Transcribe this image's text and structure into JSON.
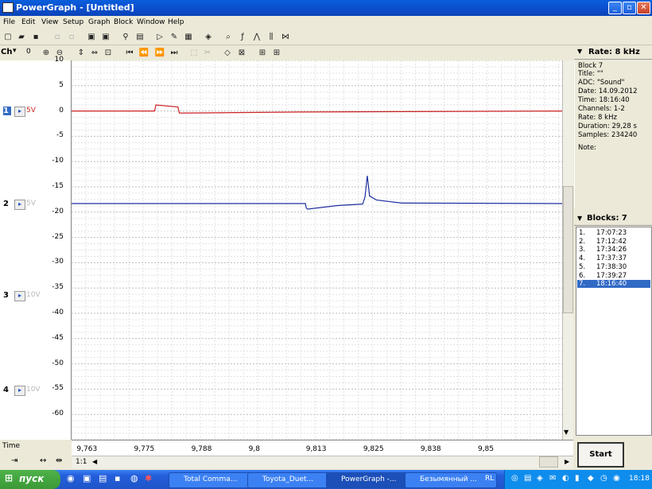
{
  "window": {
    "title": "PowerGraph - [Untitled]"
  },
  "menu": [
    "File",
    "Edit",
    "View",
    "Setup",
    "Graph",
    "Block",
    "Window",
    "Help"
  ],
  "toolbar2": {
    "ch_label": "Ch",
    "zero_label": "0"
  },
  "rate": {
    "label": "Rate: 8 kHz"
  },
  "info": {
    "block": "Block 7",
    "title": "Title: \"\"",
    "adc": "ADC: \"Sound\"",
    "date": "Date: 14.09.2012",
    "time": "Time: 18:16:40",
    "channels": "Channels: 1-2",
    "rate": "Rate: 8 kHz",
    "duration": "Duration: 29,28 s",
    "samples": "Samples: 234240",
    "note": "Note:"
  },
  "blocks": {
    "header": "Blocks: 7",
    "items": [
      {
        "num": "1.",
        "time": "17:07:23"
      },
      {
        "num": "2.",
        "time": "17:12:42"
      },
      {
        "num": "3.",
        "time": "17:34:26"
      },
      {
        "num": "4.",
        "time": "17:37:37"
      },
      {
        "num": "5.",
        "time": "17:38:30"
      },
      {
        "num": "6.",
        "time": "17:39:27"
      },
      {
        "num": "7.",
        "time": "18:16:40"
      }
    ],
    "selected_index": 6
  },
  "channels": [
    {
      "num": "1",
      "scale": "5V",
      "color": "#cc2222"
    },
    {
      "num": "2",
      "scale": "5V",
      "color": "#b8b8b8"
    },
    {
      "num": "3",
      "scale": "10V",
      "color": "#b8b8b8"
    },
    {
      "num": "4",
      "scale": "10V",
      "color": "#b8b8b8"
    }
  ],
  "y_ticks": [
    "10",
    "5",
    "0",
    "-5",
    "-10",
    "-15",
    "-20",
    "-25",
    "-30",
    "-35",
    "-40",
    "-45",
    "-50",
    "-55",
    "-60"
  ],
  "x_ticks": [
    "9,763",
    "9,775",
    "9,788",
    "9,8",
    "9,813",
    "9,825",
    "9,838",
    "9,85"
  ],
  "bottom": {
    "time_label": "Time",
    "zoom": "1:1",
    "start_button": "Start"
  },
  "taskbar": {
    "start": "пуск",
    "tasks": [
      "Total Comma...",
      "Toyota_Duet...",
      "PowerGraph -...",
      "Безымянный ..."
    ],
    "lang": "RL",
    "clock": "18:18"
  },
  "chart_data": {
    "type": "line",
    "xlim": [
      9.76,
      9.867
    ],
    "ylim": [
      -65,
      10
    ],
    "series": [
      {
        "color": "#cc2222",
        "x": [
          9.76,
          9.7781,
          9.7784,
          9.7832,
          9.7835,
          9.7855,
          9.81,
          9.867
        ],
        "y": [
          0,
          0,
          1.2,
          0.8,
          -0.4,
          -0.4,
          -0.2,
          0
        ]
      },
      {
        "color": "#1f2fa0",
        "x": [
          9.76,
          9.811,
          9.8112,
          9.8115,
          9.818,
          9.8235,
          9.824,
          9.8245,
          9.825,
          9.8265,
          9.832,
          9.867
        ],
        "y": [
          -18.3,
          -18.3,
          -19.2,
          -19.4,
          -18.7,
          -18.4,
          -17,
          -12.8,
          -16.8,
          -17.6,
          -18.2,
          -18.3
        ]
      }
    ]
  }
}
